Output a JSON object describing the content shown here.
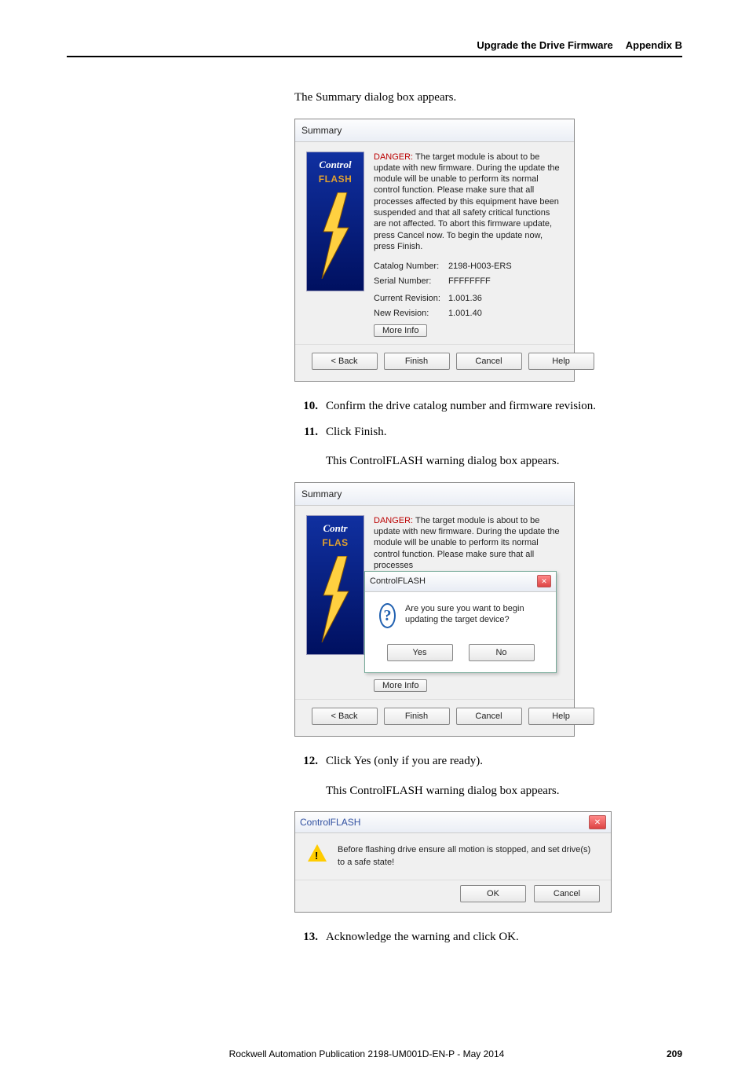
{
  "header": {
    "chapter": "Upgrade the Drive Firmware",
    "appendix": "Appendix B"
  },
  "intro1": "The Summary dialog box appears.",
  "dialog1": {
    "title": "Summary",
    "logo1": "Control",
    "logo2": "FLASH",
    "danger": "DANGER:",
    "text": " The target module is about to be update with new firmware. During the update the module will be unable to perform its normal control function. Please make sure that all processes affected by this equipment have been suspended and that all safety critical functions are not affected. To abort this firmware update, press Cancel now. To begin the update now, press Finish.",
    "catalog_label": "Catalog Number:",
    "catalog": "2198-H003-ERS",
    "serial_label": "Serial Number:",
    "serial": "FFFFFFFF",
    "current_label": "Current Revision:",
    "current": "1.001.36",
    "new_label": "New Revision:",
    "new": "1.001.40",
    "more": "More Info",
    "back": "< Back",
    "finish": "Finish",
    "cancel": "Cancel",
    "help": "Help"
  },
  "step10": {
    "num": "10.",
    "text": "Confirm the drive catalog number and firmware revision."
  },
  "step11": {
    "num": "11.",
    "text": "Click Finish."
  },
  "sub11": "This ControlFLASH warning dialog box appears.",
  "dialog2": {
    "title": "Summary",
    "logo1": "Contr",
    "logo2": "FLAS",
    "popup_title": "ControlFLASH",
    "question": "Are you sure you want to begin updating the target device?",
    "yes": "Yes",
    "no": "No"
  },
  "step12": {
    "num": "12.",
    "text": "Click Yes (only if you are ready)."
  },
  "sub12": "This ControlFLASH warning dialog box appears.",
  "dialog3": {
    "title": "ControlFLASH",
    "warn": "Before flashing drive ensure all motion is stopped, and set drive(s) to a safe state!",
    "ok": "OK",
    "cancel": "Cancel"
  },
  "step13": {
    "num": "13.",
    "text": "Acknowledge the warning and click OK."
  },
  "footer": {
    "pub": "Rockwell Automation Publication 2198-UM001D-EN-P - May 2014",
    "page": "209"
  }
}
